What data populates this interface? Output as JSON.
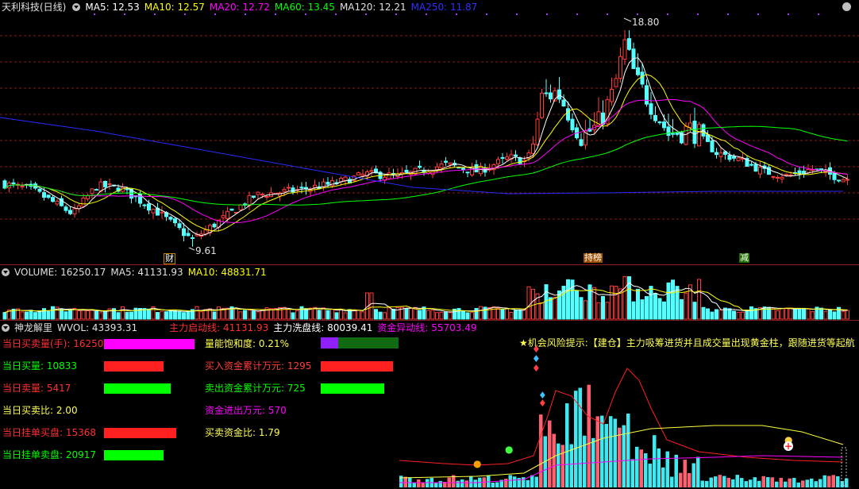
{
  "colors": {
    "up": "#ff3c3c",
    "down": "#54ffff",
    "ma5": "#ffffff",
    "ma10": "#ffff00",
    "ma20": "#ff00ff",
    "ma60": "#00ff00",
    "ma250": "#2020ff",
    "grid": "#8b1a1a",
    "magenta": "#ff00ff",
    "red": "#ff2020",
    "green": "#00ff00"
  },
  "price_panel": {
    "title": "天利科技(日线)",
    "ma5": "MA5: 12.53",
    "ma10": "MA10: 12.57",
    "ma20": "MA20: 12.72",
    "ma60": "MA60: 13.45",
    "ma120": "MA120: 12.21",
    "ma250": "MA250: 11.87",
    "high_label": "18.80",
    "low_label": "9.61",
    "markers": [
      "财",
      "持榜",
      "减"
    ]
  },
  "volume_panel": {
    "title": "VOLUME: 16250.17",
    "ma5": "MA5: 41131.93",
    "ma10": "MA10: 48831.71"
  },
  "indicator_panel": {
    "title": "神龙解里",
    "wvol": "WVOL: 43393.31",
    "line1": "主力启动线: 41131.93",
    "line2": "主力洗盘线: 80039.41",
    "line3": "资金异动线: 55703.49"
  },
  "stats_left": [
    {
      "label": "当日买卖量(手): 16250",
      "color": "#ff00ff",
      "fill": 1.0
    },
    {
      "label": "当日买量: 10833",
      "color": "#ff2020",
      "fill": 0.66
    },
    {
      "label": "当日卖量: 5417",
      "color": "#00ff00",
      "fill": 0.74
    },
    {
      "label": "当日买卖比: 2.00",
      "color": "",
      "fill": 0
    },
    {
      "label": "当日挂单买盘: 15368",
      "color": "#ff2020",
      "fill": 0.8
    },
    {
      "label": "当日挂单卖盘: 20917",
      "color": "#00ff00",
      "fill": 0.66
    }
  ],
  "stats_mid": [
    {
      "label": "量能饱和度: 0.21%",
      "color": "#ffff54",
      "fill": 0.21
    },
    {
      "label": "买入资金累计万元: 1295",
      "color": "#ff3c3c",
      "fill": 0.97
    },
    {
      "label": "卖出资金累计万元: 725",
      "color": "#00ff00",
      "fill": 0.85
    },
    {
      "label": "资金进出万元: 570",
      "color": "#ff00ff",
      "fill": 0
    },
    {
      "label": "买卖资金比: 1.79",
      "color": "#ffff54",
      "fill": 0
    }
  ],
  "notice": "★机会风险提示:【建仓】主力吸筹进货并且成交量出现黄金柱，跟随进货等起航"
}
